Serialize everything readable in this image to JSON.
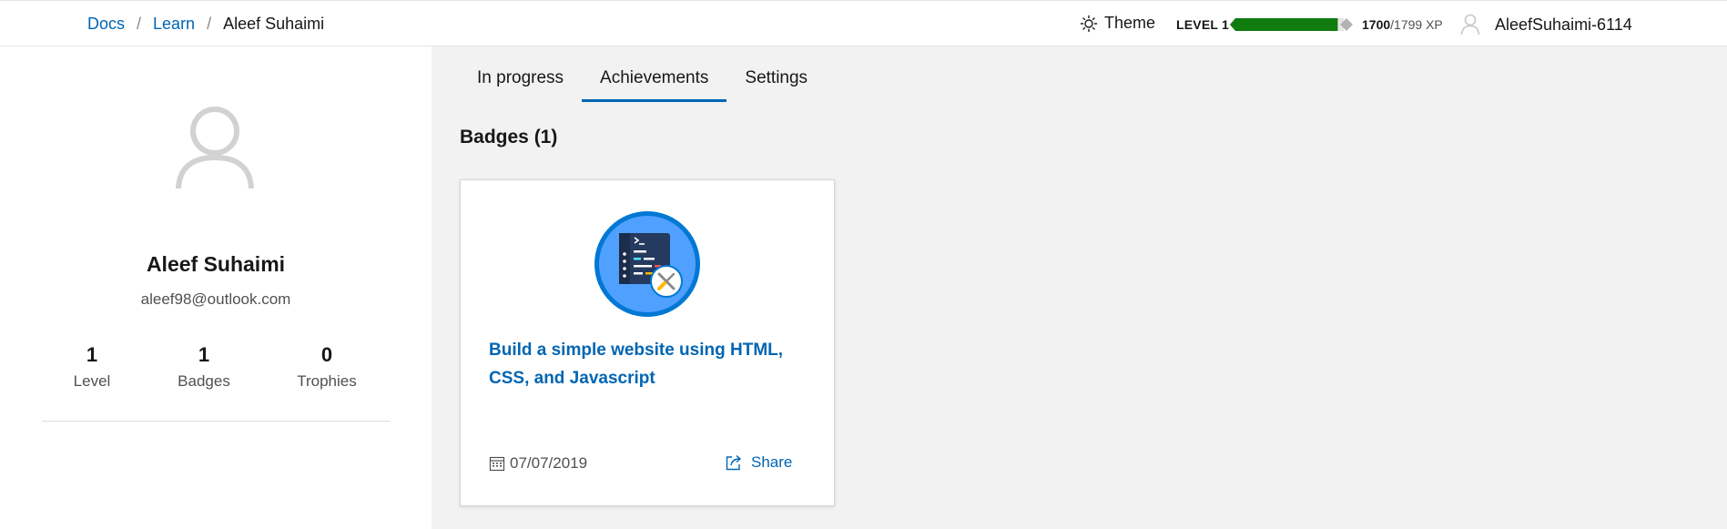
{
  "breadcrumb": {
    "items": [
      "Docs",
      "Learn"
    ],
    "separator": "/",
    "current": "Aleef Suhaimi"
  },
  "header": {
    "theme_label": "Theme",
    "level_label": "LEVEL 1",
    "xp_current": "1700",
    "xp_total": "/1799 XP",
    "xp_progress": 0.945,
    "username": "AleefSuhaimi-6114"
  },
  "profile": {
    "name": "Aleef Suhaimi",
    "email": "aleef98@outlook.com",
    "stats": [
      {
        "value": "1",
        "label": "Level"
      },
      {
        "value": "1",
        "label": "Badges"
      },
      {
        "value": "0",
        "label": "Trophies"
      }
    ]
  },
  "tabs": [
    {
      "label": "In progress",
      "active": false
    },
    {
      "label": "Achievements",
      "active": true
    },
    {
      "label": "Settings",
      "active": false
    }
  ],
  "section": {
    "title": "Badges (1)"
  },
  "badge": {
    "title": "Build a simple website using HTML, CSS, and Javascript",
    "date": "07/07/2019",
    "share_label": "Share",
    "icon": "terminal-tools-badge-icon"
  },
  "colors": {
    "link": "#0065b3",
    "xp_fill": "#107c10",
    "panel_bg": "#f2f2f2",
    "badge_ring": "#0078d4",
    "badge_fill": "#50a0ff"
  }
}
